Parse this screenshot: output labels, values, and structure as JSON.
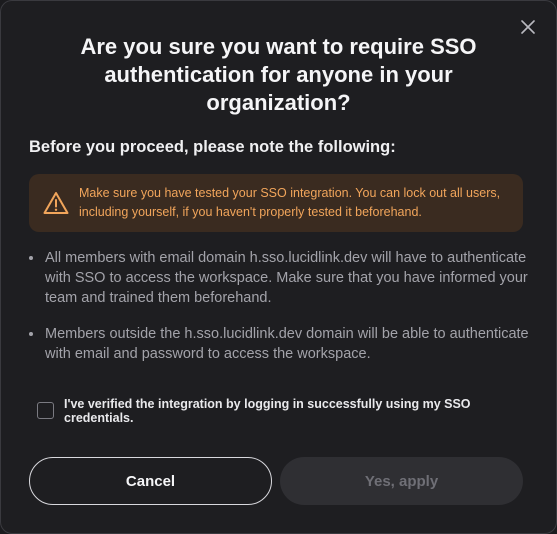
{
  "dialog": {
    "title": "Are you sure you want to require SSO authentication for anyone in your organization?",
    "subtitle": "Before you proceed, please note the following:",
    "close_icon": "close-icon",
    "warning": {
      "icon": "warning-triangle-icon",
      "text": "Make sure you have tested your SSO integration. You can lock out all users, including yourself, if you haven't properly tested it beforehand.",
      "color": "#f1a55b",
      "background": "#3a2b20"
    },
    "bullets": [
      "All members with email domain h.sso.lucidlink.dev will have to authenticate with SSO to access the workspace. Make sure that you have informed your team and trained them beforehand.",
      "Members outside the h.sso.lucidlink.dev domain will be able to authenticate with email and password to access the workspace."
    ],
    "checkbox": {
      "label": "I've verified the integration by logging in successfully using my SSO credentials.",
      "checked": false
    },
    "buttons": {
      "cancel_label": "Cancel",
      "apply_label": "Yes, apply",
      "apply_disabled": true
    }
  }
}
